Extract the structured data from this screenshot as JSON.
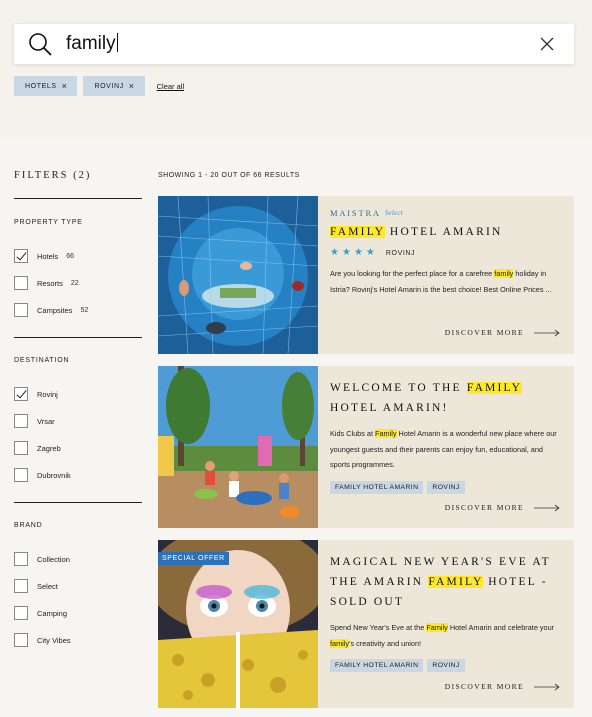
{
  "search": {
    "value": "family"
  },
  "chips": [
    {
      "label": "HOTELS"
    },
    {
      "label": "ROVINJ"
    }
  ],
  "clear_all": "Clear all",
  "filters": {
    "title": "FILTERS (2)",
    "sections": [
      {
        "title": "PROPERTY TYPE",
        "options": [
          {
            "label": "Hotels",
            "count": "66",
            "checked": true
          },
          {
            "label": "Resorts",
            "count": "22",
            "checked": false
          },
          {
            "label": "Campsites",
            "count": "52",
            "checked": false
          }
        ]
      },
      {
        "title": "DESTINATION",
        "options": [
          {
            "label": "Rovinj",
            "checked": true
          },
          {
            "label": "Vrsar",
            "checked": false
          },
          {
            "label": "Zagreb",
            "checked": false
          },
          {
            "label": "Dubrovnik",
            "checked": false
          }
        ]
      },
      {
        "title": "BRAND",
        "options": [
          {
            "label": "Collection",
            "checked": false
          },
          {
            "label": "Select",
            "checked": false
          },
          {
            "label": "Camping",
            "checked": false
          },
          {
            "label": "City Vibes",
            "checked": false
          }
        ]
      }
    ]
  },
  "results": {
    "showing": "SHOWING 1 - 20 OUT OF 66 RESULTS",
    "cards": [
      {
        "brand": "MAISTRA",
        "brand_sub": "Select",
        "title_hl": "FAMILY",
        "title_rest": " HOTEL AMARIN",
        "stars": 4,
        "location": "ROVINJ",
        "desc_a": "Are you looking for the perfect place for a carefree ",
        "desc_hl": "family",
        "desc_b": " holiday in Istria? Rovinj's Hotel Amarin is the best choice! Best Online Prices ...",
        "more": "DISCOVER MORE"
      },
      {
        "title_a": "WELCOME TO THE ",
        "title_hl": "FAMILY",
        "title_b": " HOTEL AMARIN!",
        "desc_a": "Kids Clubs at ",
        "desc_hl": "Family",
        "desc_b": " Hotel Amarin is a wonderful new place where our youngest guests and their parents can enjoy fun, educational, and sports programmes.",
        "tags": [
          "FAMILY HOTEL AMARIN",
          "ROVINJ"
        ],
        "more": "DISCOVER MORE"
      },
      {
        "badge": "SPECIAL OFFER",
        "title_a": "MAGICAL NEW YEAR'S EVE AT THE AMARIN ",
        "title_hl": "FAMILY",
        "title_b": " HOTEL - SOLD OUT",
        "desc_a": "Spend New Year's Eve at the ",
        "desc_hl": "Family",
        "desc_b": " Hotel Amarin and celebrate your ",
        "desc_hl2": "family",
        "desc_c": "'s creativity and union!",
        "tags": [
          "FAMILY HOTEL AMARIN",
          "ROVINJ"
        ],
        "more": "DISCOVER MORE"
      }
    ]
  },
  "colors": {
    "accent_blue": "#2d71b8",
    "highlight": "#ffe82a",
    "chip_bg": "#c9d6e3",
    "card_bg": "#ede7d9"
  }
}
